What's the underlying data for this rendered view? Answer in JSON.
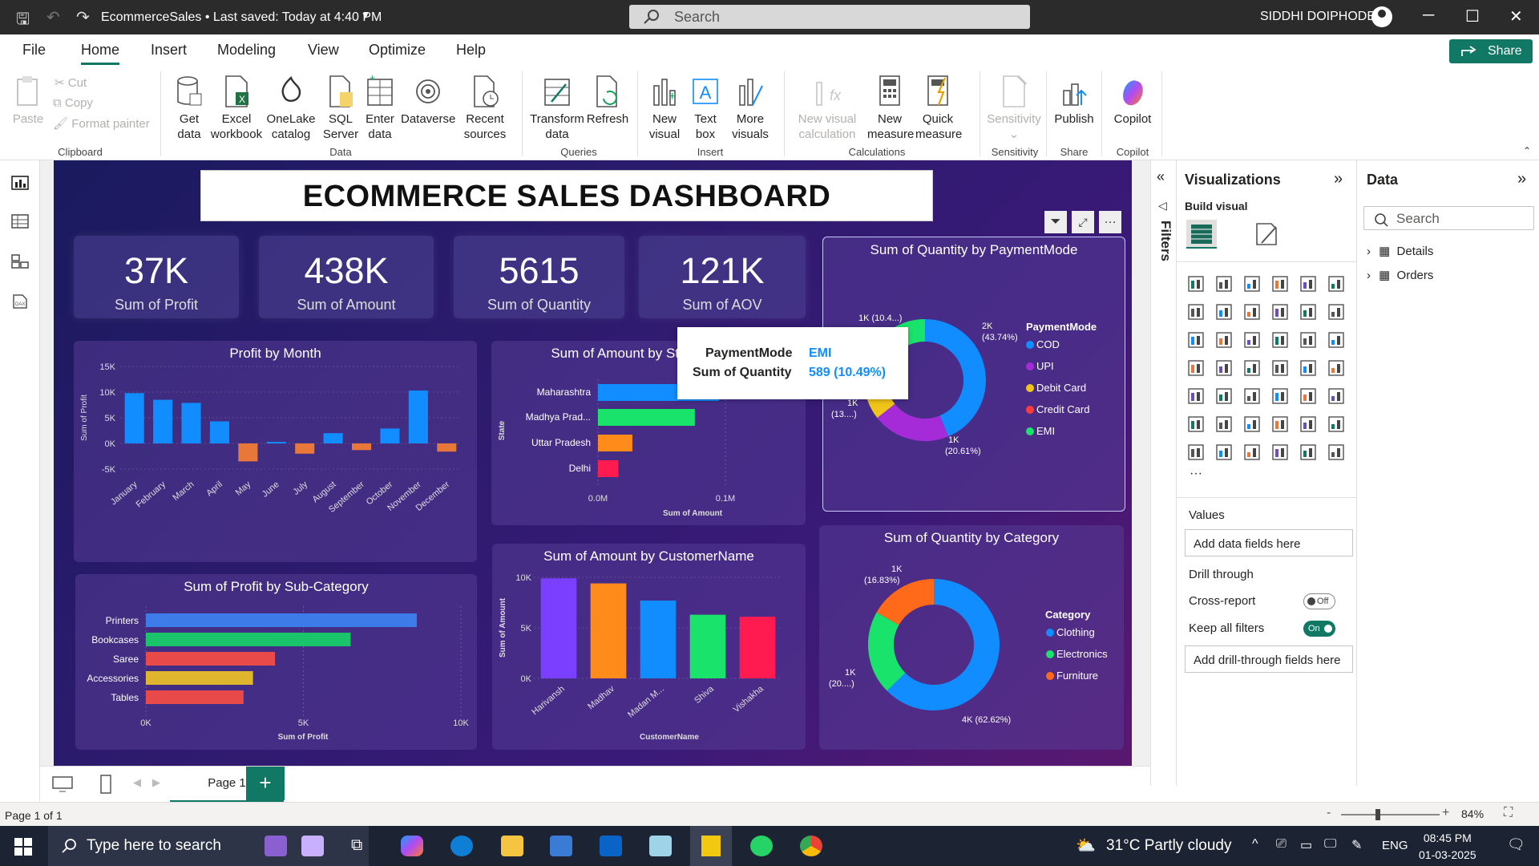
{
  "titlebar": {
    "title": "EcommerceSales • Last saved: Today at 4:40 PM",
    "search": "Search",
    "user": "SIDDHI DOIPHODE"
  },
  "menu": {
    "file": "File",
    "home": "Home",
    "insert": "Insert",
    "modeling": "Modeling",
    "view": "View",
    "optimize": "Optimize",
    "help": "Help",
    "share": "Share"
  },
  "ribbon": {
    "paste": "Paste",
    "cut": "Cut",
    "copy": "Copy",
    "format_painter": "Format painter",
    "get_data": [
      "Get",
      "data"
    ],
    "excel": [
      "Excel",
      "workbook"
    ],
    "onelake": [
      "OneLake",
      "catalog"
    ],
    "sql": [
      "SQL",
      "Server"
    ],
    "enter": [
      "Enter",
      "data"
    ],
    "dataverse": [
      "Dataverse",
      ""
    ],
    "recent": [
      "Recent",
      "sources"
    ],
    "transform": [
      "Transform",
      "data"
    ],
    "refresh": [
      "Refresh",
      ""
    ],
    "new_visual": [
      "New",
      "visual"
    ],
    "text_box": [
      "Text",
      "box"
    ],
    "more_visuals": [
      "More",
      "visuals"
    ],
    "new_visual_calc": [
      "New visual",
      "calculation"
    ],
    "new_measure": [
      "New",
      "measure"
    ],
    "quick_measure": [
      "Quick",
      "measure"
    ],
    "sensitivity": [
      "Sensitivity",
      ""
    ],
    "publish": [
      "Publish",
      ""
    ],
    "copilot": [
      "Copilot",
      ""
    ],
    "groups": {
      "clipboard": "Clipboard",
      "data": "Data",
      "queries": "Queries",
      "insert": "Insert",
      "calculations": "Calculations",
      "sensitivity": "Sensitivity",
      "share": "Share",
      "copilot": "Copilot"
    }
  },
  "dashboard": {
    "title": "ECOMMERCE SALES DASHBOARD",
    "kpis": [
      {
        "value": "37K",
        "label": "Sum of Profit"
      },
      {
        "value": "438K",
        "label": "Sum of Amount"
      },
      {
        "value": "5615",
        "label": "Sum of Quantity"
      },
      {
        "value": "121K",
        "label": "Sum of AOV"
      }
    ],
    "tooltip": {
      "k1": "PaymentMode",
      "v1": "EMI",
      "k2": "Sum of Quantity",
      "v2": "589 (10.49%)"
    }
  },
  "chart_data": [
    {
      "type": "bar",
      "title": "Profit by Month",
      "ylabel": "Sum of Profit",
      "xlabel": "",
      "categories": [
        "January",
        "February",
        "March",
        "April",
        "May",
        "June",
        "July",
        "August",
        "September",
        "October",
        "November",
        "December"
      ],
      "values": [
        9800,
        8500,
        7900,
        4300,
        -3500,
        300,
        -2000,
        2000,
        -1300,
        2900,
        10300,
        -1600
      ],
      "ylim": [
        -5000,
        15000
      ],
      "yticks": [
        "15K",
        "10K",
        "5K",
        "0K",
        "-5K"
      ],
      "colors": {
        "pos": "#118dff",
        "neg": "#e8773a"
      }
    },
    {
      "type": "bar",
      "title": "Sum of Amount by State",
      "ylabel": "State",
      "xlabel": "Sum of Amount",
      "categories": [
        "Maharashtra",
        "Madhya Prad...",
        "Uttar Pradesh",
        "Delhi"
      ],
      "values": [
        95000,
        76000,
        27000,
        16000
      ],
      "xticks": [
        "0.0M",
        "0.1M"
      ],
      "colors": [
        "#118dff",
        "#19e36b",
        "#ff8c1a",
        "#ff1a4f"
      ]
    },
    {
      "type": "pie",
      "title": "Sum of Quantity by PaymentMode",
      "legend_title": "PaymentMode",
      "slices": [
        {
          "name": "COD",
          "value": 43.74,
          "color": "#118dff"
        },
        {
          "name": "UPI",
          "value": 20.61,
          "color": "#a52bd8"
        },
        {
          "name": "Debit Card",
          "value": 6.5,
          "color": "#f0c419"
        },
        {
          "name": "Credit Card",
          "value": 18.66,
          "color": "#ff3b3b"
        },
        {
          "name": "EMI",
          "value": 10.49,
          "color": "#19e36b"
        }
      ],
      "labels": [
        "2K",
        "(43.74%)",
        "1K",
        "(20.61%)",
        "1K",
        "(13....)",
        "1K (10.4...)"
      ]
    },
    {
      "type": "bar",
      "title": "Sum of Profit by Sub-Category",
      "xlabel": "Sum of Profit",
      "categories": [
        "Printers",
        "Bookcases",
        "Saree",
        "Accessories",
        "Tables"
      ],
      "values": [
        8600,
        6500,
        4100,
        3400,
        3100
      ],
      "xticks": [
        "0K",
        "5K",
        "10K"
      ],
      "colors": [
        "#3d7be8",
        "#19c46b",
        "#e84a4a",
        "#e0b52e",
        "#e84a4a"
      ]
    },
    {
      "type": "bar",
      "title": "Sum of Amount by CustomerName",
      "ylabel": "Sum of Amount",
      "xlabel": "CustomerName",
      "categories": [
        "Harivansh",
        "Madhav",
        "Madan M...",
        "Shiva",
        "Vishakha"
      ],
      "values": [
        9900,
        9400,
        7700,
        6300,
        6100
      ],
      "yticks": [
        "10K",
        "5K",
        "0K"
      ],
      "colors": [
        "#7b3fff",
        "#ff8c1a",
        "#118dff",
        "#19e36b",
        "#ff1a4f"
      ]
    },
    {
      "type": "pie",
      "title": "Sum of Quantity by Category",
      "legend_title": "Category",
      "slices": [
        {
          "name": "Clothing",
          "value": 62.62,
          "color": "#118dff"
        },
        {
          "name": "Electronics",
          "value": 20.55,
          "color": "#19e36b"
        },
        {
          "name": "Furniture",
          "value": 16.83,
          "color": "#ff6a1a"
        }
      ],
      "labels": [
        "1K",
        "(16.83%)",
        "1K",
        "(20....)",
        "4K (62.62%)"
      ]
    }
  ],
  "filters": {
    "label": "Filters"
  },
  "viz": {
    "title": "Visualizations",
    "build": "Build visual",
    "values": "Values",
    "add_fields": "Add data fields here",
    "drill": "Drill through",
    "cross": "Cross-report",
    "cross_state": "Off",
    "keep": "Keep all filters",
    "keep_state": "On",
    "add_drill": "Add drill-through fields here"
  },
  "data": {
    "title": "Data",
    "search": "Search",
    "tables": [
      "Details",
      "Orders"
    ]
  },
  "pages": {
    "page1": "Page 1",
    "info": "Page 1 of 1",
    "zoom": "84%"
  },
  "taskbar": {
    "search": "Type here to search",
    "weather": "31°C  Partly cloudy",
    "lang": "ENG",
    "time": "08:45 PM",
    "date": "01-03-2025"
  }
}
